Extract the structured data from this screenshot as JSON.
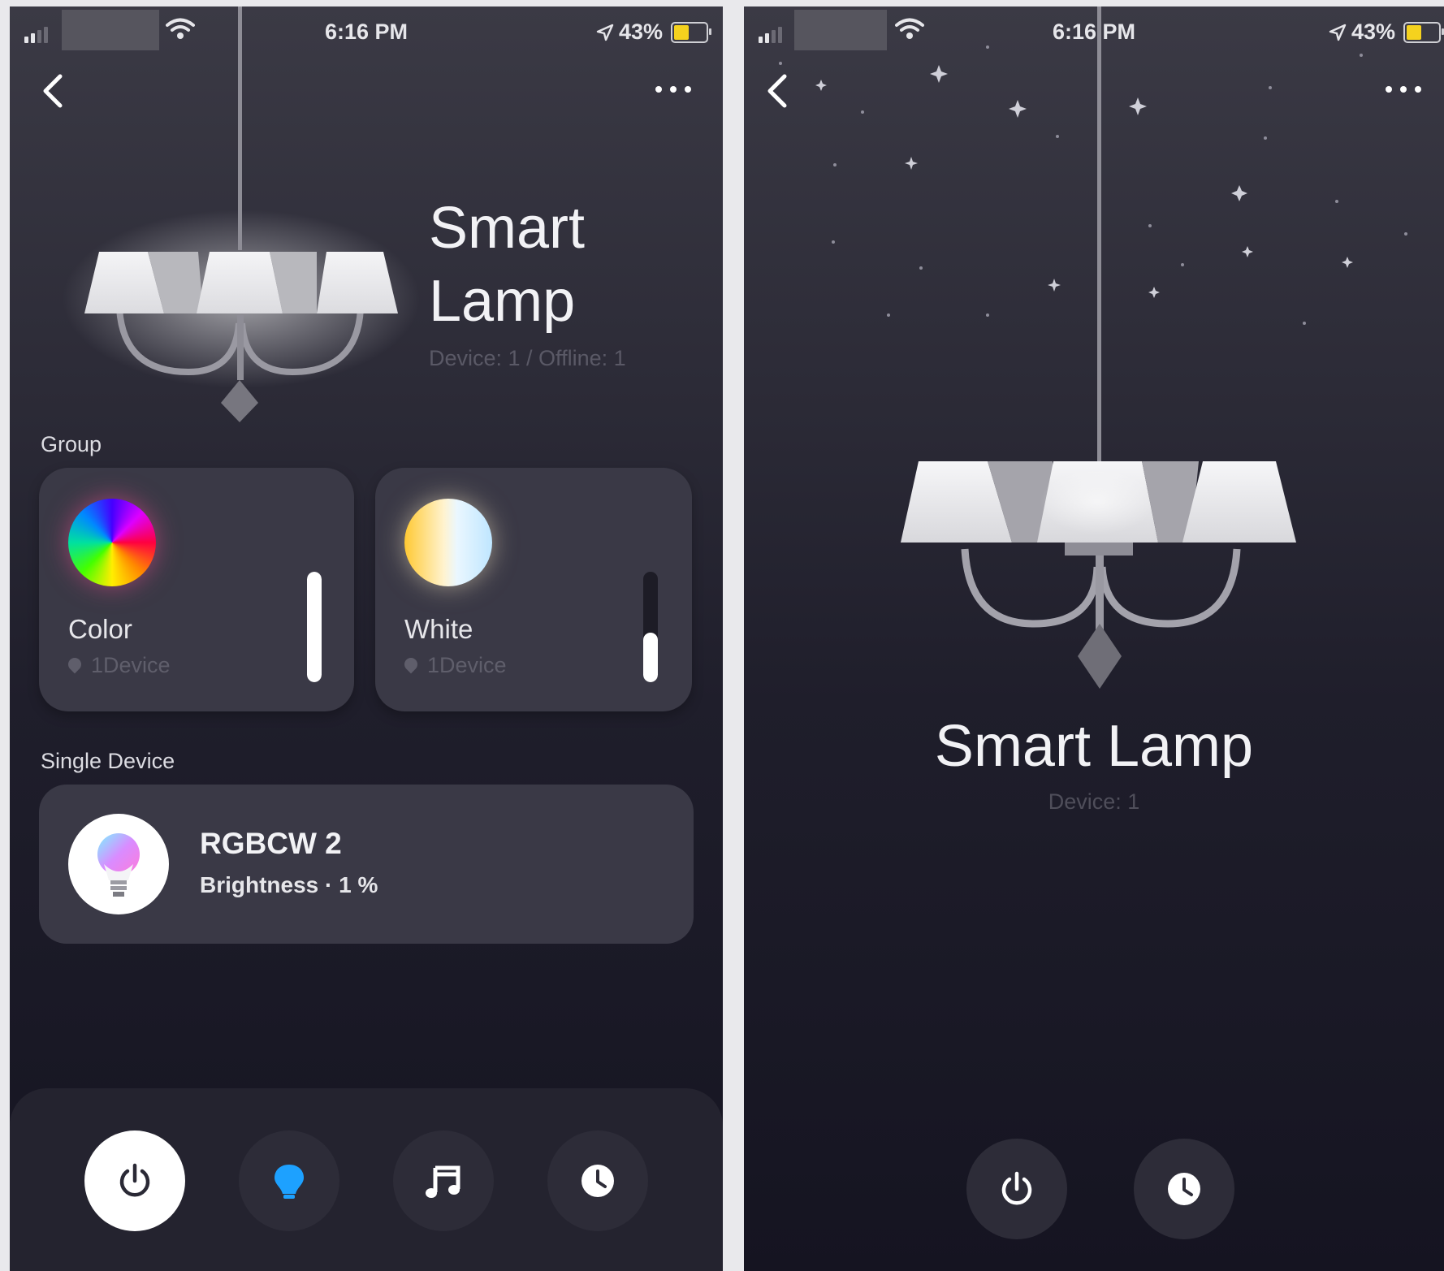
{
  "colors": {
    "background": "#15151f",
    "card": "#3a3946",
    "accent_blue": "#1da1ff",
    "slider_fill": "#ffffff"
  },
  "screens": [
    {
      "status_bar": {
        "time": "6:16 PM",
        "battery": "43%"
      },
      "header": {
        "title_line1": "Smart",
        "title_line2": "Lamp",
        "subtitle": "Device: 1 / Offline: 1"
      },
      "group": {
        "label": "Group",
        "cards": [
          {
            "title": "Color",
            "meta": "1Device",
            "brightness_level": 1.0,
            "swatch": "rainbow-color-icon"
          },
          {
            "title": "White",
            "meta": "1Device",
            "brightness_level": 0.45,
            "swatch": "warm-white-icon"
          }
        ]
      },
      "single_device": {
        "label": "Single Device",
        "device": {
          "name": "RGBCW 2",
          "brightness": "Brightness · 1 %",
          "icon": "bulb-icon"
        }
      },
      "bottom_bar": {
        "buttons": [
          "power-icon",
          "bulb-icon",
          "music-icon",
          "clock-icon"
        ]
      }
    },
    {
      "status_bar": {
        "time": "6:16 PM",
        "battery": "43%"
      },
      "header": {
        "title": "Smart Lamp",
        "subtitle": "Device: 1"
      },
      "bottom_bar": {
        "buttons": [
          "power-icon",
          "clock-icon"
        ]
      }
    }
  ]
}
